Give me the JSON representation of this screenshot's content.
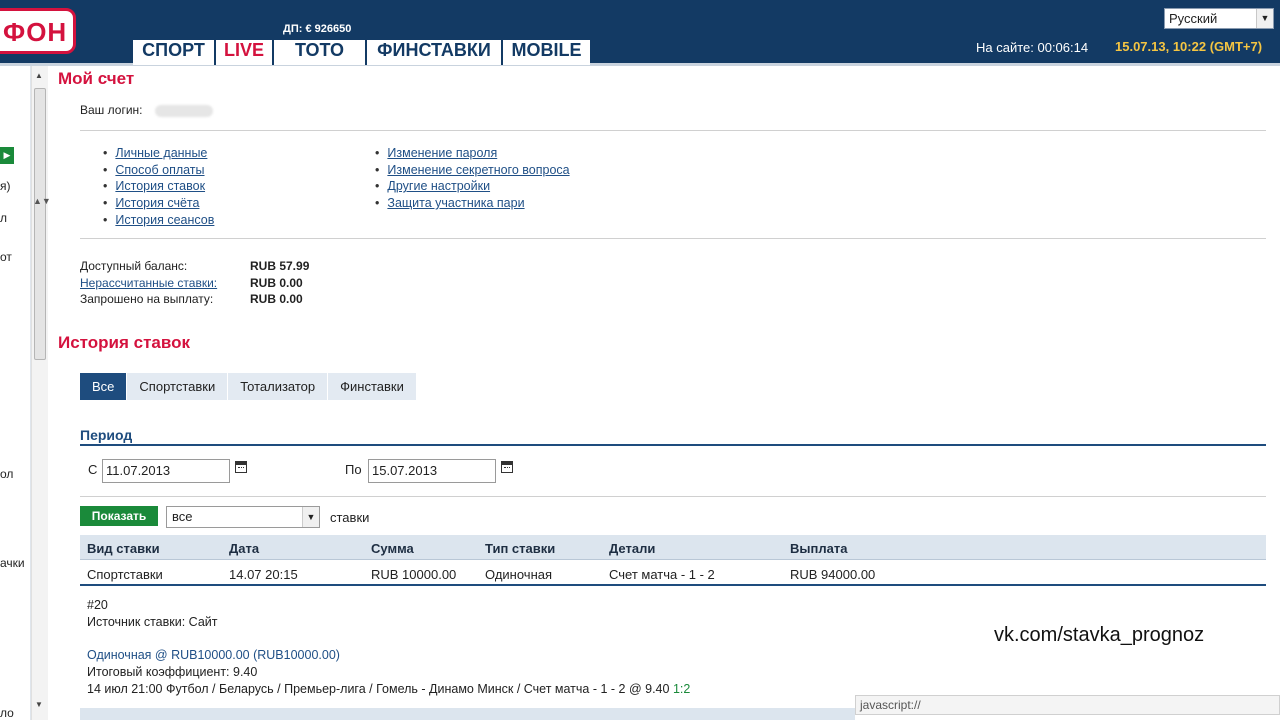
{
  "header": {
    "logo_text": "ФОН",
    "dp_text": "ДП: € 926650",
    "nav": [
      "СПОРТ",
      "LIVE",
      "ТОТО",
      "ФИНСТАВКИ",
      "MOBILE"
    ],
    "language": "Русский",
    "onsite": "На сайте: 00:06:14",
    "datetime": "15.07.13, 10:22 (GMT+7)"
  },
  "sidebar_fragments": [
    "я)",
    "л",
    "от",
    "ол",
    "ачки",
    "ло"
  ],
  "account": {
    "title": "Мой счет",
    "login_label": "Ваш логин:",
    "links_left": [
      "Личные данные",
      "Способ оплаты",
      "История ставок",
      "История счёта",
      "История сеансов"
    ],
    "links_right": [
      "Изменение пароля",
      "Изменение секретного вопроса",
      "Другие настройки",
      "Защита участника пари"
    ],
    "balance": [
      {
        "label": "Доступный баланс:",
        "value": "RUB 57.99"
      },
      {
        "label": "Нерассчитанные ставки:",
        "value": "RUB 0.00"
      },
      {
        "label": "Запрошено на выплату:",
        "value": "RUB 0.00"
      }
    ]
  },
  "history": {
    "title": "История ставок",
    "tabs": [
      "Все",
      "Спортставки",
      "Тотализатор",
      "Финставки"
    ],
    "period_title": "Период",
    "from_label": "С",
    "from_value": "11.07.2013",
    "to_label": "По",
    "to_value": "15.07.2013",
    "show_button": "Показать",
    "filter_value": "все",
    "filter_suffix": "ставки",
    "columns": [
      "Вид ставки",
      "Дата",
      "Сумма",
      "Тип ставки",
      "Детали",
      "Выплата"
    ],
    "row": [
      "Спортставки",
      "14.07 20:15",
      "RUB 10000.00",
      "Одиночная",
      "Счет матча - 1 - 2",
      "RUB 94000.00"
    ],
    "detail": {
      "id": "#20",
      "source": "Источник ставки: Сайт",
      "summary": "Одиночная @ RUB10000.00 (RUB10000.00)",
      "coef": "Итоговый коэффициент: 9.40",
      "event": "14 июл 21:00 Футбол / Беларусь / Премьер-лига / Гомель - Динамо Минск / Счет матча - 1 - 2 @ 9.40",
      "score": "1:2"
    }
  },
  "watermark": "vk.com/stavka_prognoz",
  "status_bar": "javascript://"
}
